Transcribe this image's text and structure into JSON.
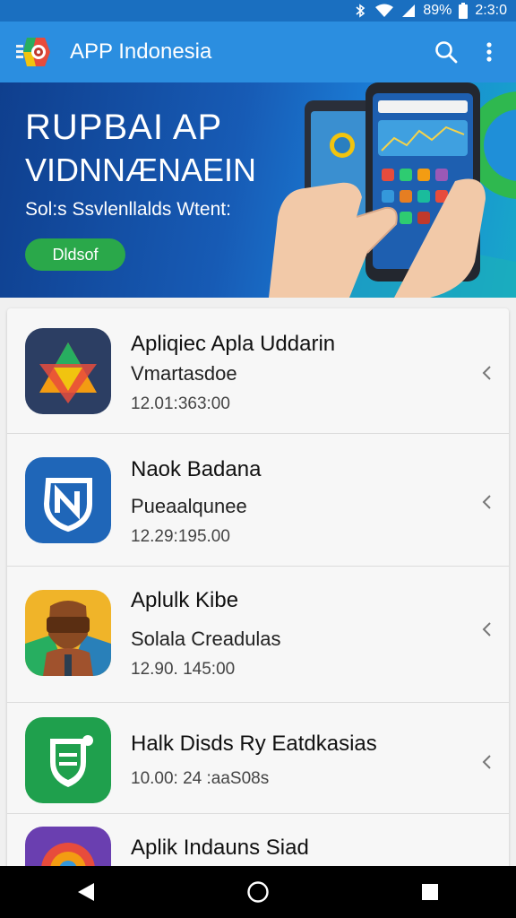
{
  "status_bar": {
    "battery": "89%",
    "time": "2:3:0"
  },
  "app_bar": {
    "title": "APP Indonesia"
  },
  "banner": {
    "line1": "RUPBAI AP",
    "line2": "VIDNNÆNAEIN",
    "subtitle": "Sol:s Ssvlenllalds Wtent:",
    "button_label": "Dldsof"
  },
  "list": {
    "items": [
      {
        "title": "Apliqiec Apla Uddarin",
        "subtitle": "Vmartasdoe",
        "meta": "12.01:363:00",
        "icon": "triangle-star-icon"
      },
      {
        "title": "Naok Badana",
        "subtitle": "Pueaalqunee",
        "meta": "12.29:195.00",
        "icon": "shield-n-icon"
      },
      {
        "title": "Aplulk Kibe",
        "subtitle": "Solala Creadulas",
        "meta": "12.90. 145:00",
        "icon": "person-face-icon"
      },
      {
        "title": "Halk Disds Ry Eatdkasias",
        "subtitle": "",
        "meta": "10.00: 24 :aaS08s",
        "icon": "green-shield-icon"
      },
      {
        "title": "Aplik Indauns Siad",
        "subtitle": "",
        "meta": "",
        "icon": "colorful-circle-icon"
      }
    ]
  },
  "colors": {
    "status_bar": "#1a6fc0",
    "app_bar": "#2b8ee0",
    "banner_button": "#2aa84a",
    "nav_bar": "#000000"
  }
}
